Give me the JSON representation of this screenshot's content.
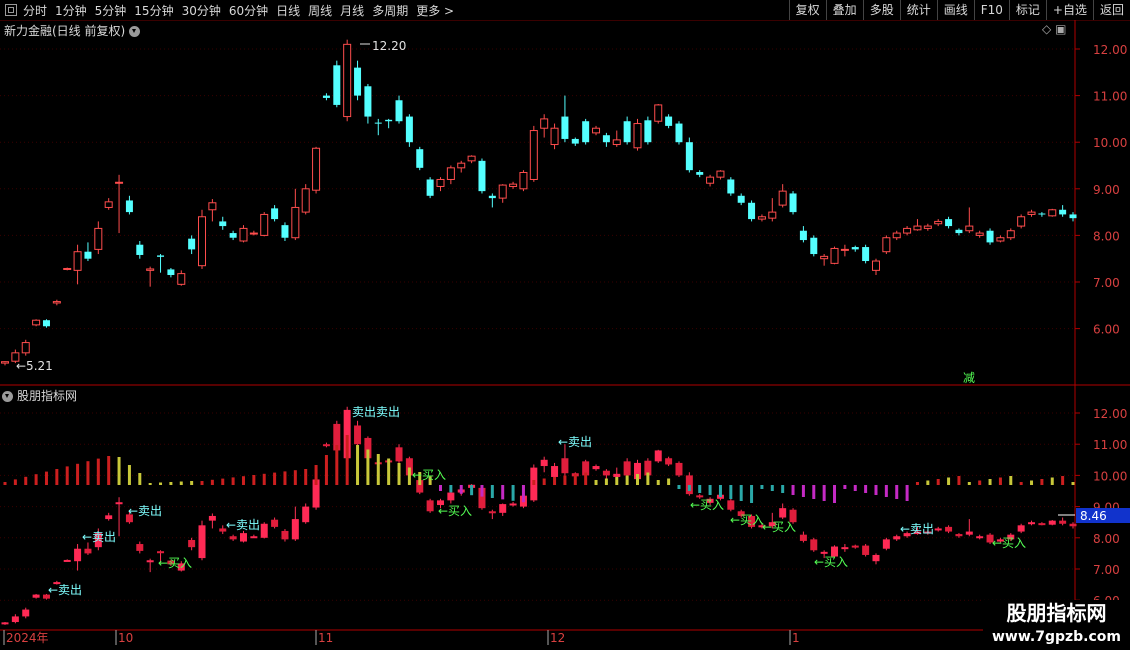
{
  "toolbar": {
    "periods": [
      "分时",
      "1分钟",
      "5分钟",
      "15分钟",
      "30分钟",
      "60分钟",
      "日线",
      "周线",
      "月线",
      "多周期",
      "更多 >"
    ],
    "right_buttons": [
      "复权",
      "叠加",
      "多股",
      "统计",
      "画线",
      "F10",
      "标记",
      "+自选",
      "返回"
    ]
  },
  "main_pane": {
    "title": "新力金融(日线 前复权)",
    "high_label": "12.20",
    "low_label": "←5.21",
    "marker": "减",
    "y_ticks": [
      "12.00",
      "11.00",
      "10.00",
      "9.00",
      "8.00",
      "7.00",
      "6.00"
    ]
  },
  "indicator_pane": {
    "title": "股朋指标网",
    "last_price": "8.46",
    "y_ticks": [
      "12.00",
      "11.00",
      "10.00",
      "9.00",
      "8.00",
      "7.00",
      "6.00"
    ],
    "signal_labels": [
      "←卖出",
      "←卖出",
      "←卖出",
      "←卖出",
      "卖出卖出",
      "←卖出",
      "←卖出",
      "←买入",
      "←买入",
      "←买入",
      "←买入",
      "←买入",
      "←买入",
      "←买入"
    ]
  },
  "time_axis": [
    "2024年",
    "10",
    "11",
    "12",
    "1"
  ],
  "watermark": {
    "title": "股朋指标网",
    "url": "www.7gpzb.com"
  },
  "colors": {
    "up": "#ff4d4d",
    "down": "#54ffff",
    "axis": "#b00000",
    "sell": "#7fffff",
    "buy": "#54ff54",
    "macd_red": "#cc1f1f",
    "macd_yellow": "#c8c83a",
    "macd_cyan": "#2aa8a8",
    "macd_magenta": "#c42ac4"
  },
  "chart_data": {
    "type": "candlestick",
    "ylim": [
      5.0,
      12.5
    ],
    "candles": [
      [
        5.26,
        5.29,
        5.21,
        5.3
      ],
      [
        5.3,
        5.48,
        5.26,
        5.55
      ],
      [
        5.48,
        5.7,
        5.42,
        5.76
      ],
      [
        6.08,
        6.18,
        6.05,
        6.2
      ],
      [
        6.18,
        6.05,
        6.02,
        6.2
      ],
      [
        6.55,
        6.58,
        6.5,
        6.62
      ],
      [
        7.27,
        7.29,
        7.25,
        7.31
      ],
      [
        7.25,
        7.65,
        6.95,
        7.8
      ],
      [
        7.65,
        7.5,
        7.45,
        7.85
      ],
      [
        7.7,
        8.15,
        7.6,
        8.3
      ],
      [
        8.6,
        8.72,
        8.55,
        8.8
      ],
      [
        9.12,
        9.14,
        8.05,
        9.3
      ],
      [
        8.75,
        8.5,
        8.45,
        8.85
      ],
      [
        7.8,
        7.58,
        7.5,
        7.88
      ],
      [
        7.25,
        7.28,
        6.9,
        7.33
      ],
      [
        7.57,
        7.54,
        7.2,
        7.6
      ],
      [
        7.27,
        7.15,
        7.1,
        7.3
      ],
      [
        6.95,
        7.18,
        6.92,
        7.25
      ],
      [
        7.93,
        7.7,
        7.6,
        8.0
      ],
      [
        7.35,
        8.4,
        7.28,
        8.55
      ],
      [
        8.55,
        8.7,
        8.3,
        8.78
      ],
      [
        8.3,
        8.2,
        8.12,
        8.4
      ],
      [
        8.05,
        7.95,
        7.9,
        8.1
      ],
      [
        7.88,
        8.15,
        7.85,
        8.22
      ],
      [
        8.04,
        8.05,
        8.0,
        8.1
      ],
      [
        8.0,
        8.45,
        7.98,
        8.5
      ],
      [
        8.58,
        8.35,
        8.3,
        8.65
      ],
      [
        8.22,
        7.95,
        7.88,
        8.28
      ],
      [
        7.95,
        8.6,
        7.9,
        9.0
      ],
      [
        8.5,
        9.0,
        8.45,
        9.1
      ],
      [
        8.97,
        9.87,
        8.9,
        9.9
      ],
      [
        11.0,
        10.95,
        10.9,
        11.05
      ],
      [
        11.65,
        10.8,
        10.75,
        11.75
      ],
      [
        10.55,
        12.1,
        10.45,
        12.2
      ],
      [
        11.6,
        11.0,
        10.9,
        11.75
      ],
      [
        11.2,
        10.55,
        10.4,
        11.25
      ],
      [
        10.42,
        10.4,
        10.15,
        10.5
      ],
      [
        10.48,
        10.45,
        10.3,
        10.5
      ],
      [
        10.9,
        10.45,
        10.4,
        11.0
      ],
      [
        10.55,
        10.0,
        9.9,
        10.6
      ],
      [
        9.85,
        9.45,
        9.4,
        9.9
      ],
      [
        9.2,
        8.85,
        8.8,
        9.25
      ],
      [
        9.05,
        9.2,
        8.95,
        9.25
      ],
      [
        9.2,
        9.45,
        9.1,
        9.5
      ],
      [
        9.45,
        9.55,
        9.35,
        9.6
      ],
      [
        9.6,
        9.7,
        9.55,
        9.72
      ],
      [
        9.6,
        8.95,
        8.9,
        9.65
      ],
      [
        8.85,
        8.8,
        8.6,
        8.9
      ],
      [
        8.8,
        9.08,
        8.7,
        9.1
      ],
      [
        9.05,
        9.1,
        9.0,
        9.15
      ],
      [
        9.0,
        9.35,
        8.95,
        9.4
      ],
      [
        9.2,
        10.25,
        9.15,
        10.35
      ],
      [
        10.3,
        10.5,
        10.1,
        10.6
      ],
      [
        9.95,
        10.3,
        9.85,
        10.4
      ],
      [
        10.55,
        10.07,
        10.0,
        11.0
      ],
      [
        10.07,
        9.97,
        9.92,
        10.1
      ],
      [
        10.45,
        10.0,
        9.95,
        10.5
      ],
      [
        10.2,
        10.3,
        10.15,
        10.35
      ],
      [
        10.15,
        10.0,
        9.9,
        10.2
      ],
      [
        9.95,
        10.05,
        9.9,
        10.25
      ],
      [
        10.45,
        10.0,
        9.95,
        10.55
      ],
      [
        9.88,
        10.4,
        9.82,
        10.5
      ],
      [
        10.47,
        10.0,
        9.95,
        10.55
      ],
      [
        10.45,
        10.8,
        10.4,
        10.82
      ],
      [
        10.55,
        10.35,
        10.3,
        10.6
      ],
      [
        10.4,
        10.0,
        9.95,
        10.45
      ],
      [
        10.0,
        9.4,
        9.35,
        10.1
      ],
      [
        9.36,
        9.3,
        9.25,
        9.4
      ],
      [
        9.12,
        9.25,
        9.05,
        9.3
      ],
      [
        9.25,
        9.38,
        9.2,
        9.4
      ],
      [
        9.2,
        8.9,
        8.85,
        9.25
      ],
      [
        8.85,
        8.7,
        8.65,
        8.9
      ],
      [
        8.7,
        8.35,
        8.3,
        8.75
      ],
      [
        8.35,
        8.4,
        8.3,
        8.45
      ],
      [
        8.37,
        8.5,
        8.3,
        8.8
      ],
      [
        8.65,
        8.95,
        8.6,
        9.1
      ],
      [
        8.9,
        8.5,
        8.45,
        8.95
      ],
      [
        8.1,
        7.9,
        7.85,
        8.2
      ],
      [
        7.95,
        7.6,
        7.55,
        8.0
      ],
      [
        7.5,
        7.55,
        7.35,
        7.6
      ],
      [
        7.4,
        7.72,
        7.38,
        7.76
      ],
      [
        7.68,
        7.7,
        7.55,
        7.8
      ],
      [
        7.75,
        7.7,
        7.65,
        7.78
      ],
      [
        7.75,
        7.45,
        7.4,
        7.8
      ],
      [
        7.25,
        7.45,
        7.15,
        7.5
      ],
      [
        7.65,
        7.95,
        7.6,
        8.0
      ],
      [
        7.95,
        8.05,
        7.9,
        8.1
      ],
      [
        8.05,
        8.15,
        8.0,
        8.2
      ],
      [
        8.12,
        8.2,
        8.1,
        8.35
      ],
      [
        8.15,
        8.2,
        8.1,
        8.25
      ],
      [
        8.25,
        8.3,
        8.2,
        8.35
      ],
      [
        8.35,
        8.2,
        8.15,
        8.4
      ],
      [
        8.12,
        8.05,
        8.0,
        8.15
      ],
      [
        8.1,
        8.2,
        8.05,
        8.6
      ],
      [
        8.0,
        8.05,
        7.95,
        8.1
      ],
      [
        8.1,
        7.85,
        7.8,
        8.15
      ],
      [
        7.88,
        7.95,
        7.85,
        8.0
      ],
      [
        7.95,
        8.1,
        7.9,
        8.15
      ],
      [
        8.2,
        8.4,
        8.15,
        8.45
      ],
      [
        8.45,
        8.5,
        8.4,
        8.55
      ],
      [
        8.47,
        8.45,
        8.4,
        8.5
      ],
      [
        8.42,
        8.55,
        8.4,
        8.57
      ],
      [
        8.55,
        8.45,
        8.4,
        8.65
      ],
      [
        8.45,
        8.37,
        8.3,
        8.5
      ]
    ]
  }
}
